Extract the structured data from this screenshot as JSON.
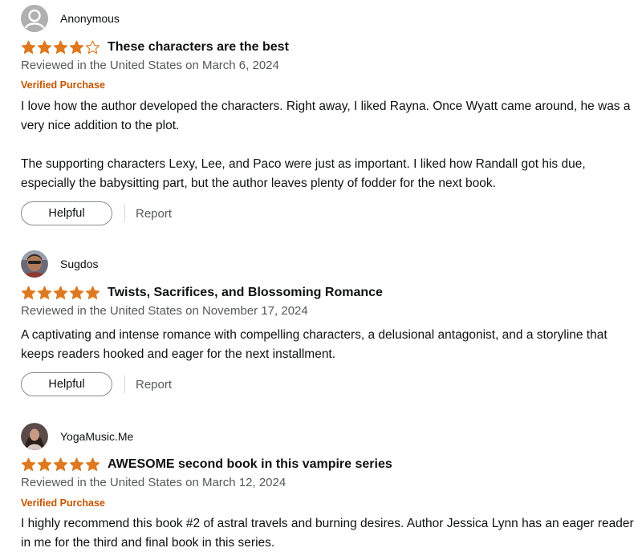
{
  "reviews": [
    {
      "reviewer": "Anonymous",
      "avatar_icon": "default-user-icon",
      "rating": 4,
      "rating_max": 5,
      "title": "These characters are the best",
      "date": "Reviewed in the United States on March 6, 2024",
      "verified": "Verified Purchase",
      "paragraphs": [
        "I love how the author developed the characters. Right away, I liked Rayna. Once Wyatt came around, he was a very nice addition to the plot.",
        "The supporting characters Lexy, Lee, and Paco were just as important. I liked how Randall got his due, especially the babysitting part, but the author leaves plenty of fodder for the next book."
      ],
      "helpful_label": "Helpful",
      "report_label": "Report"
    },
    {
      "reviewer": "Sugdos",
      "avatar_icon": "profile-photo",
      "rating": 5,
      "rating_max": 5,
      "title": "Twists, Sacrifices, and Blossoming Romance",
      "date": "Reviewed in the United States on November 17, 2024",
      "paragraphs": [
        "A captivating and intense romance with compelling characters, a delusional antagonist, and a storyline that keeps readers hooked and eager for the next installment."
      ],
      "helpful_label": "Helpful",
      "report_label": "Report"
    },
    {
      "reviewer": "YogaMusic.Me",
      "avatar_icon": "profile-photo",
      "rating": 5,
      "rating_max": 5,
      "title": "AWESOME second book in this vampire series",
      "date": "Reviewed in the United States on March 12, 2024",
      "verified": "Verified Purchase",
      "paragraphs": [
        "I highly recommend this book #2 of astral travels and burning desires. Author Jessica Lynn has an eager reader in me for the third and final book in this series."
      ]
    }
  ],
  "colors": {
    "star_fill": "#de7921",
    "verified": "#c45500",
    "muted_text": "#565959",
    "text": "#0f1111"
  }
}
